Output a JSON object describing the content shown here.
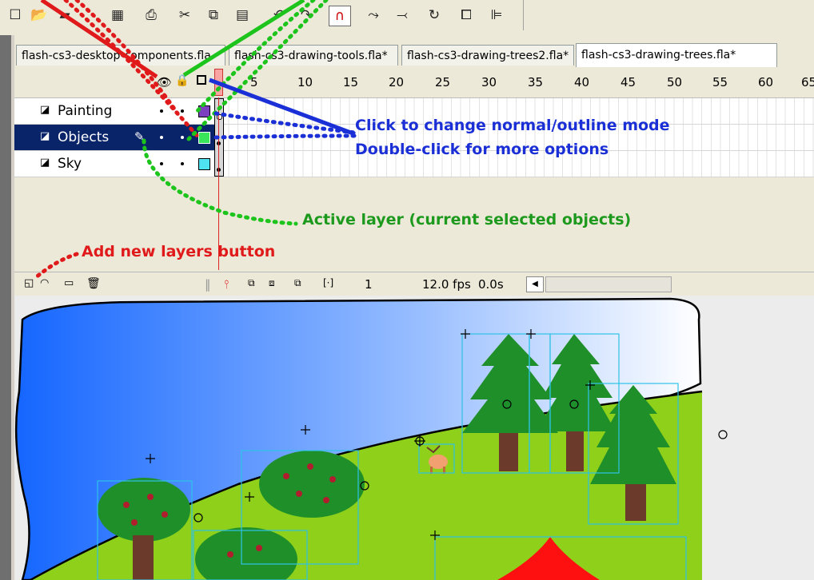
{
  "tabs": [
    {
      "label": "flash-cs3-desktop-components.fla"
    },
    {
      "label": "flash-cs3-drawing-tools.fla*"
    },
    {
      "label": "flash-cs3-drawing-trees2.fla*"
    },
    {
      "label": "flash-cs3-drawing-trees.fla*"
    }
  ],
  "frame_numbers": [
    "5",
    "10",
    "15",
    "20",
    "25",
    "30",
    "35",
    "40",
    "45",
    "50",
    "55",
    "60",
    "65"
  ],
  "layers": [
    {
      "name": "Painting",
      "color": "#7b3fbf"
    },
    {
      "name": "Objects",
      "color": "#39e65a"
    },
    {
      "name": "Sky",
      "color": "#4fe3f2"
    }
  ],
  "timeline_status": {
    "current_frame": "1",
    "fps": "12.0 fps",
    "time": "0.0s"
  },
  "annotations": {
    "outline_line1": "Click to change normal/outline mode",
    "outline_line2": "Double-click for more options",
    "active_layer": "Active layer (current selected objects)",
    "add_layer": "Add new layers button"
  },
  "colors": {
    "annotation_blue": "#1a2fd6",
    "annotation_green": "#1d9a1d",
    "annotation_red": "#e01a1a",
    "selected_layer": "#0a246a",
    "sky_blue": "#1a66ff",
    "grass": "#8fd11a",
    "tree_green": "#1f8f2a"
  },
  "icons": [
    "new-document-icon",
    "open-icon",
    "save-icon",
    "print-icon",
    "cut-icon",
    "copy-icon",
    "paste-icon",
    "magnet-icon",
    "smooth-icon",
    "straighten-icon",
    "rotate-icon",
    "scale-icon",
    "align-icon",
    "eye-icon",
    "lock-icon",
    "outline-square-icon"
  ]
}
